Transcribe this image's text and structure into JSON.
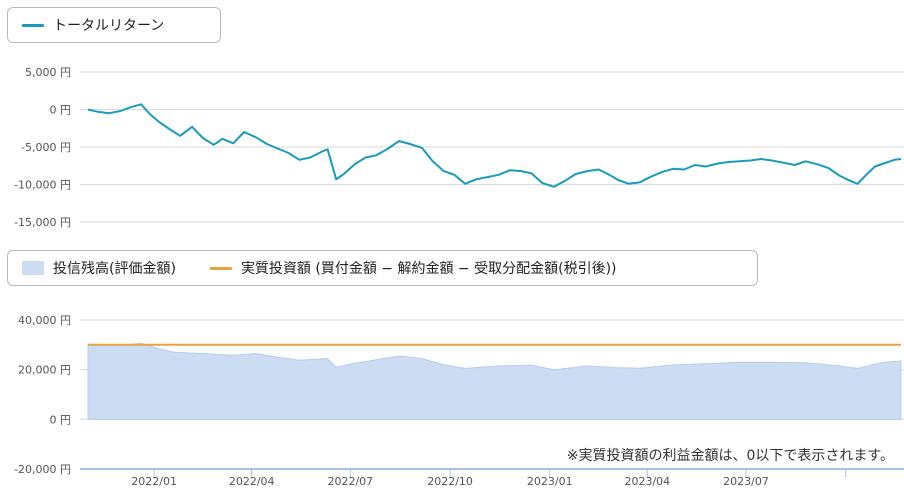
{
  "chart_data": [
    {
      "type": "line",
      "title": "",
      "legend": [
        {
          "name": "トータルリターン",
          "color": "#1a9bbd"
        }
      ],
      "y_ticks": [
        "5,000 円",
        "0 円",
        "-5,000 円",
        "-10,000 円",
        "-15,000 円"
      ],
      "ylim": [
        -15000,
        5000
      ],
      "grid": true,
      "series": [
        {
          "name": "トータルリターン",
          "color": "#1a9bbd",
          "points": [
            [
              "2021-11-01",
              0
            ],
            [
              "2021-11-10",
              -300
            ],
            [
              "2021-11-20",
              -500
            ],
            [
              "2021-12-01",
              -200
            ],
            [
              "2021-12-10",
              300
            ],
            [
              "2021-12-20",
              700
            ],
            [
              "2021-12-28",
              -600
            ],
            [
              "2022-01-05",
              -1600
            ],
            [
              "2022-01-15",
              -2600
            ],
            [
              "2022-01-25",
              -3500
            ],
            [
              "2022-02-05",
              -2300
            ],
            [
              "2022-02-15",
              -3800
            ],
            [
              "2022-02-25",
              -4700
            ],
            [
              "2022-03-05",
              -3900
            ],
            [
              "2022-03-15",
              -4500
            ],
            [
              "2022-03-25",
              -3000
            ],
            [
              "2022-04-05",
              -3700
            ],
            [
              "2022-04-15",
              -4600
            ],
            [
              "2022-04-25",
              -5200
            ],
            [
              "2022-05-05",
              -5800
            ],
            [
              "2022-05-15",
              -6700
            ],
            [
              "2022-05-25",
              -6400
            ],
            [
              "2022-06-05",
              -5600
            ],
            [
              "2022-06-10",
              -5300
            ],
            [
              "2022-06-18",
              -9300
            ],
            [
              "2022-06-25",
              -8600
            ],
            [
              "2022-07-05",
              -7300
            ],
            [
              "2022-07-15",
              -6400
            ],
            [
              "2022-07-25",
              -6100
            ],
            [
              "2022-08-05",
              -5200
            ],
            [
              "2022-08-15",
              -4200
            ],
            [
              "2022-08-25",
              -4600
            ],
            [
              "2022-09-05",
              -5100
            ],
            [
              "2022-09-15",
              -6900
            ],
            [
              "2022-09-25",
              -8200
            ],
            [
              "2022-10-05",
              -8700
            ],
            [
              "2022-10-15",
              -9900
            ],
            [
              "2022-10-25",
              -9300
            ],
            [
              "2022-11-05",
              -9000
            ],
            [
              "2022-11-15",
              -8700
            ],
            [
              "2022-11-25",
              -8100
            ],
            [
              "2022-12-05",
              -8200
            ],
            [
              "2022-12-15",
              -8500
            ],
            [
              "2022-12-25",
              -9800
            ],
            [
              "2023-01-05",
              -10300
            ],
            [
              "2023-01-15",
              -9500
            ],
            [
              "2023-01-25",
              -8600
            ],
            [
              "2023-02-05",
              -8200
            ],
            [
              "2023-02-15",
              -8000
            ],
            [
              "2023-02-25",
              -8700
            ],
            [
              "2023-03-05",
              -9400
            ],
            [
              "2023-03-15",
              -9900
            ],
            [
              "2023-03-25",
              -9700
            ],
            [
              "2023-04-05",
              -8900
            ],
            [
              "2023-04-15",
              -8300
            ],
            [
              "2023-04-25",
              -7900
            ],
            [
              "2023-05-05",
              -8000
            ],
            [
              "2023-05-15",
              -7400
            ],
            [
              "2023-05-25",
              -7600
            ],
            [
              "2023-06-05",
              -7200
            ],
            [
              "2023-06-15",
              -7000
            ],
            [
              "2023-06-25",
              -6900
            ],
            [
              "2023-07-05",
              -6800
            ],
            [
              "2023-07-15",
              -6600
            ],
            [
              "2023-07-25",
              -6800
            ],
            [
              "2023-08-05",
              -7100
            ],
            [
              "2023-08-15",
              -7400
            ],
            [
              "2023-08-25",
              -6900
            ],
            [
              "2023-09-05",
              -7300
            ],
            [
              "2023-09-15",
              -7800
            ],
            [
              "2023-09-25",
              -8800
            ],
            [
              "2023-10-05",
              -9500
            ],
            [
              "2023-10-12",
              -9900
            ],
            [
              "2023-10-20",
              -8700
            ],
            [
              "2023-10-28",
              -7600
            ],
            [
              "2023-11-05",
              -7200
            ],
            [
              "2023-11-15",
              -6700
            ],
            [
              "2023-11-21",
              -6600
            ]
          ]
        }
      ]
    },
    {
      "type": "area",
      "title": "",
      "legend": [
        {
          "name": "投信残高(評価金額)",
          "color": "#cbdcf3",
          "kind": "area"
        },
        {
          "name": "実質投資額 (買付金額 − 解約金額 − 受取分配金額(税引後))",
          "color": "#e8a33b",
          "kind": "line"
        }
      ],
      "y_ticks": [
        "40,000 円",
        "20,000 円",
        "0 円",
        "-20,000 円"
      ],
      "ylim": [
        -20000,
        40000
      ],
      "grid": true,
      "x_ticks": [
        "2022/01",
        "2022/04",
        "2022/07",
        "2022/10",
        "2023/01",
        "2023/04",
        "2023/07"
      ],
      "series": [
        {
          "name": "投信残高(評価金額)",
          "type": "area",
          "color": "#cbdcf3",
          "points": [
            [
              "2021-11-01",
              30000
            ],
            [
              "2021-12-01",
              29800
            ],
            [
              "2021-12-20",
              30600
            ],
            [
              "2022-01-05",
              28500
            ],
            [
              "2022-01-20",
              27000
            ],
            [
              "2022-02-15",
              26500
            ],
            [
              "2022-03-15",
              25800
            ],
            [
              "2022-04-05",
              26500
            ],
            [
              "2022-04-25",
              25000
            ],
            [
              "2022-05-15",
              23800
            ],
            [
              "2022-06-10",
              24500
            ],
            [
              "2022-06-18",
              21000
            ],
            [
              "2022-07-05",
              22600
            ],
            [
              "2022-07-25",
              24000
            ],
            [
              "2022-08-15",
              25500
            ],
            [
              "2022-09-05",
              24500
            ],
            [
              "2022-09-25",
              22000
            ],
            [
              "2022-10-15",
              20500
            ],
            [
              "2022-11-15",
              21500
            ],
            [
              "2022-12-15",
              21800
            ],
            [
              "2023-01-05",
              20000
            ],
            [
              "2023-02-05",
              21500
            ],
            [
              "2023-03-05",
              20800
            ],
            [
              "2023-03-25",
              20600
            ],
            [
              "2023-04-25",
              21900
            ],
            [
              "2023-05-25",
              22400
            ],
            [
              "2023-06-25",
              23000
            ],
            [
              "2023-07-25",
              23000
            ],
            [
              "2023-08-25",
              22800
            ],
            [
              "2023-09-25",
              21500
            ],
            [
              "2023-10-12",
              20500
            ],
            [
              "2023-11-05",
              23000
            ],
            [
              "2023-11-21",
              23500
            ]
          ]
        },
        {
          "name": "実質投資額 (買付金額 − 解約金額 − 受取分配金額(税引後))",
          "type": "line",
          "color": "#e8a33b",
          "points": [
            [
              "2021-11-01",
              30000
            ],
            [
              "2023-11-21",
              30000
            ]
          ]
        }
      ]
    }
  ],
  "note": "※実質投資額の利益金額は、0以下で表示されます。"
}
